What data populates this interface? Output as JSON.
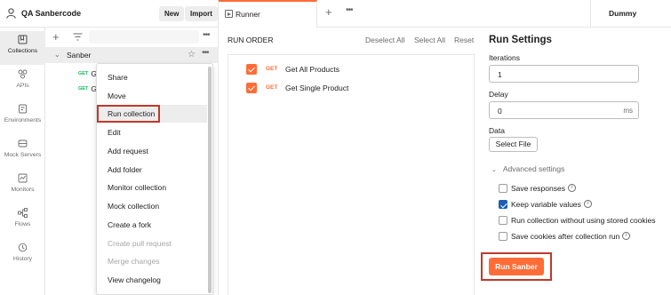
{
  "header": {
    "workspace_name": "QA Sanbercode",
    "new_label": "New",
    "import_label": "Import"
  },
  "tabs": [
    {
      "label": "Runner",
      "icon": "runner-icon"
    }
  ],
  "environment": {
    "selected": "Dummy"
  },
  "rail": {
    "items": [
      {
        "label": "Collections",
        "icon": "collections-icon",
        "active": true
      },
      {
        "label": "APIs",
        "icon": "apis-icon"
      },
      {
        "label": "Environments",
        "icon": "environments-icon"
      },
      {
        "label": "Mock Servers",
        "icon": "mock-servers-icon"
      },
      {
        "label": "Monitors",
        "icon": "monitors-icon"
      },
      {
        "label": "Flows",
        "icon": "flows-icon"
      },
      {
        "label": "History",
        "icon": "history-icon"
      }
    ]
  },
  "collections": {
    "collection_name": "Sanber",
    "requests": [
      {
        "method": "GET",
        "name": "Ge"
      },
      {
        "method": "GET",
        "name": "Ge"
      }
    ]
  },
  "context_menu": {
    "items": [
      {
        "label": "Share",
        "disabled": false
      },
      {
        "label": "Move",
        "disabled": false
      },
      {
        "label": "Run collection",
        "disabled": false,
        "highlighted": true
      },
      {
        "label": "Edit",
        "disabled": false
      },
      {
        "label": "Add request",
        "disabled": false
      },
      {
        "label": "Add folder",
        "disabled": false
      },
      {
        "label": "Monitor collection",
        "disabled": false
      },
      {
        "label": "Mock collection",
        "disabled": false
      },
      {
        "label": "Create a fork",
        "disabled": false
      },
      {
        "label": "Create pull request",
        "disabled": true
      },
      {
        "label": "Merge changes",
        "disabled": true
      },
      {
        "label": "View changelog",
        "disabled": false
      }
    ]
  },
  "run_order": {
    "title": "RUN ORDER",
    "deselect_all": "Deselect All",
    "select_all": "Select All",
    "reset": "Reset",
    "items": [
      {
        "method": "GET",
        "name": "Get All Products",
        "checked": true
      },
      {
        "method": "GET",
        "name": "Get Single Product",
        "checked": true
      }
    ]
  },
  "run_settings": {
    "title": "Run Settings",
    "iterations_label": "Iterations",
    "iterations_value": "1",
    "delay_label": "Delay",
    "delay_value": "0",
    "delay_unit": "ms",
    "data_label": "Data",
    "select_file_label": "Select File",
    "advanced_label": "Advanced settings",
    "options": [
      {
        "label": "Save responses",
        "checked": false,
        "info": true
      },
      {
        "label": "Keep variable values",
        "checked": true,
        "info": true
      },
      {
        "label": "Run collection without using stored cookies",
        "checked": false,
        "info": false
      },
      {
        "label": "Save cookies after collection run",
        "checked": false,
        "info": true
      }
    ],
    "run_button_label": "Run Sanber"
  },
  "colors": {
    "accent": "#ff6c37",
    "checkbox_blue": "#1a5fb4",
    "get_green": "#0cbb52",
    "highlight_red": "#c0392b"
  }
}
